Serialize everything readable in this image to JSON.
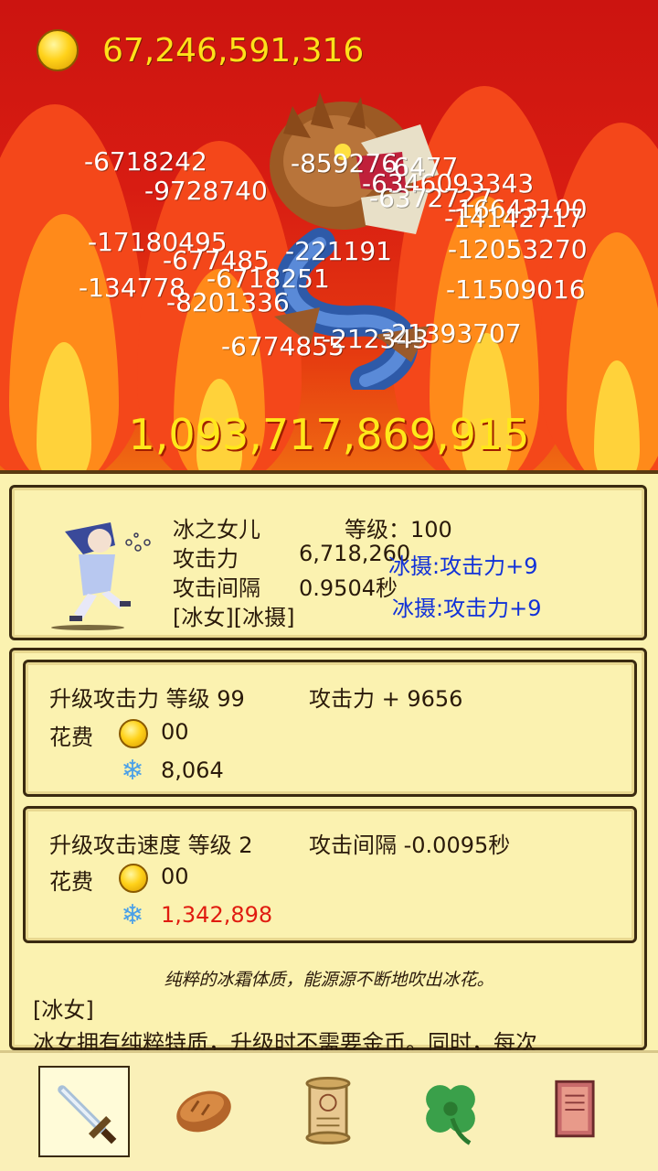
{
  "currency": {
    "amount": "67,246,591,316",
    "icon": "gold-coin-icon"
  },
  "boss": {
    "hp": "1,093,717,869,915",
    "icon": "serpent-dragon-icon"
  },
  "damage_numbers": [
    "-6718242",
    "-9728740",
    "-859276",
    "-6477",
    "-6346093343",
    "-6372727",
    "-16643100",
    "-14142717",
    "-17180495",
    "-677485",
    "-221191",
    "-12053270",
    "-134778",
    "-6718251",
    "-8201336",
    "-11509016",
    "-6774855",
    "-212343",
    "-21393707"
  ],
  "hero": {
    "name": "冰之女儿",
    "level_label": "等级：100",
    "attack_label": "攻击力",
    "attack_value": "6,718,260",
    "interval_label": "攻击间隔",
    "interval_value": "0.9504秒",
    "tags": "[冰女][冰摄]",
    "buff_1": "冰摄:攻击力+9",
    "buff_2": "冰摄:攻击力+9"
  },
  "upgrades": [
    {
      "title": "升级攻击力 等级 99",
      "effect": "攻击力 + 9656",
      "cost_label": "花费",
      "gold_cost": "00",
      "ice_cost": "8,064"
    },
    {
      "title": "升级攻击速度 等级 2",
      "effect": "攻击间隔 -0.0095秒",
      "cost_label": "花费",
      "gold_cost": "00",
      "ice_cost": "1,342,898"
    }
  ],
  "description": {
    "flavor": "纯粹的冰霜体质，能源源不断地吹出冰花。",
    "tag_title": "[冰女]",
    "tag_text": "冰女拥有纯粹特质，升级时不需要金币。同时，每次"
  },
  "nav": [
    "sword-icon",
    "bread-icon",
    "scroll-icon",
    "clover-icon",
    "book-icon"
  ],
  "colors": {
    "gold_text": "#ffe11a",
    "buff_text": "#1232d8",
    "insufficient": "#e01c10",
    "panel": "#fbf2b0"
  }
}
